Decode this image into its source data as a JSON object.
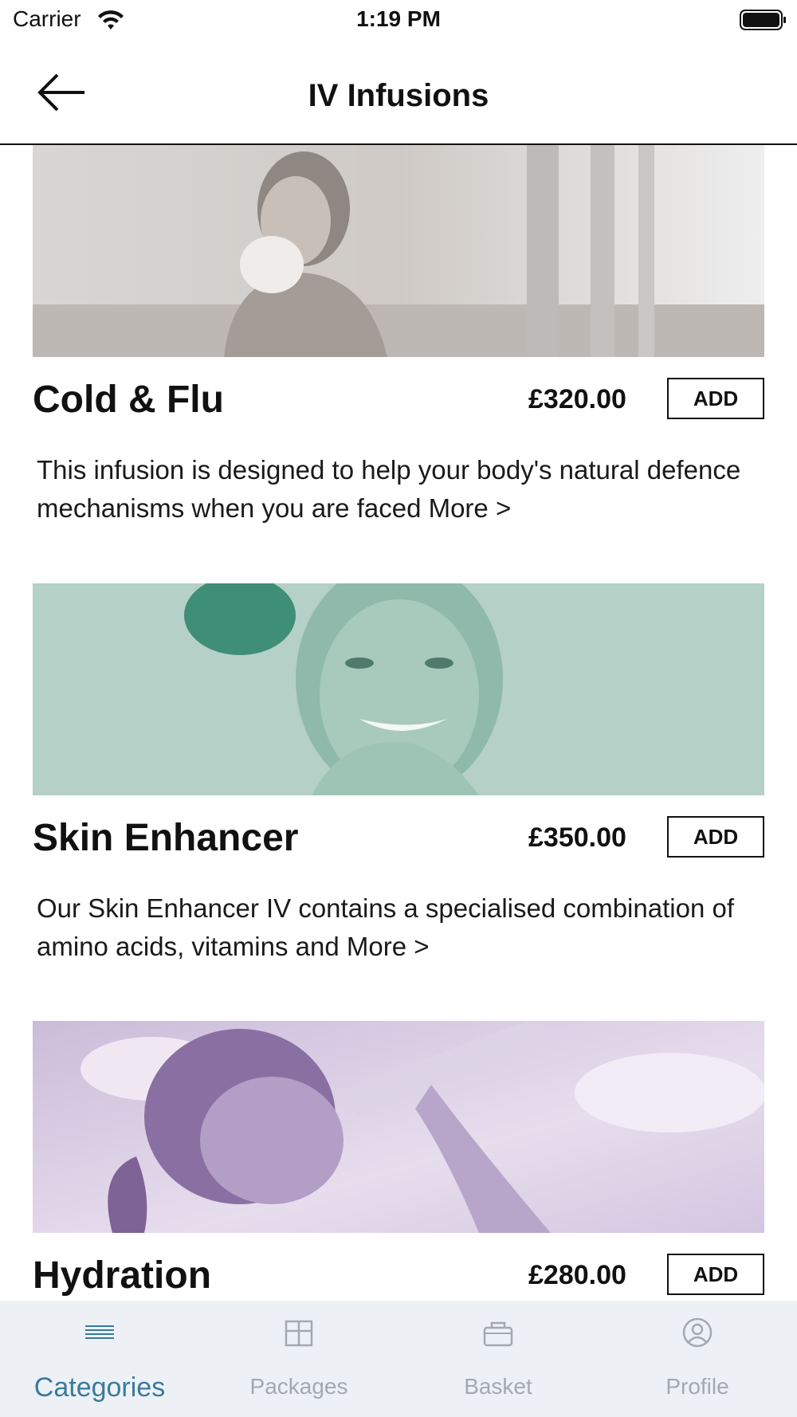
{
  "status_bar": {
    "carrier": "Carrier",
    "time": "1:19 PM"
  },
  "nav": {
    "title": "IV Infusions",
    "back_icon": "arrow-left-icon"
  },
  "products": [
    {
      "title": "Cold & Flu",
      "price": "£320.00",
      "add_label": "ADD",
      "description": "This infusion is designed to help your body's natural defence mechanisms when you are faced ",
      "more_label": "More >",
      "image_tint": "#8f8a86"
    },
    {
      "title": "Skin Enhancer",
      "price": "£350.00",
      "add_label": "ADD",
      "description": "Our Skin Enhancer IV contains a specialised combination of amino acids, vitamins and ",
      "more_label": "More >",
      "image_tint": "#5f9e8c"
    },
    {
      "title": "Hydration",
      "price": "£280.00",
      "add_label": "ADD",
      "description": "",
      "more_label": "",
      "image_tint": "#9b86b0"
    }
  ],
  "tab_bar": {
    "active_color": "#3a7a9c",
    "inactive_color": "#a3a9b0",
    "tabs": [
      {
        "label": "Categories",
        "icon": "list-icon",
        "active": true
      },
      {
        "label": "Packages",
        "icon": "package-icon",
        "active": false
      },
      {
        "label": "Basket",
        "icon": "basket-icon",
        "active": false
      },
      {
        "label": "Profile",
        "icon": "profile-icon",
        "active": false
      }
    ]
  }
}
